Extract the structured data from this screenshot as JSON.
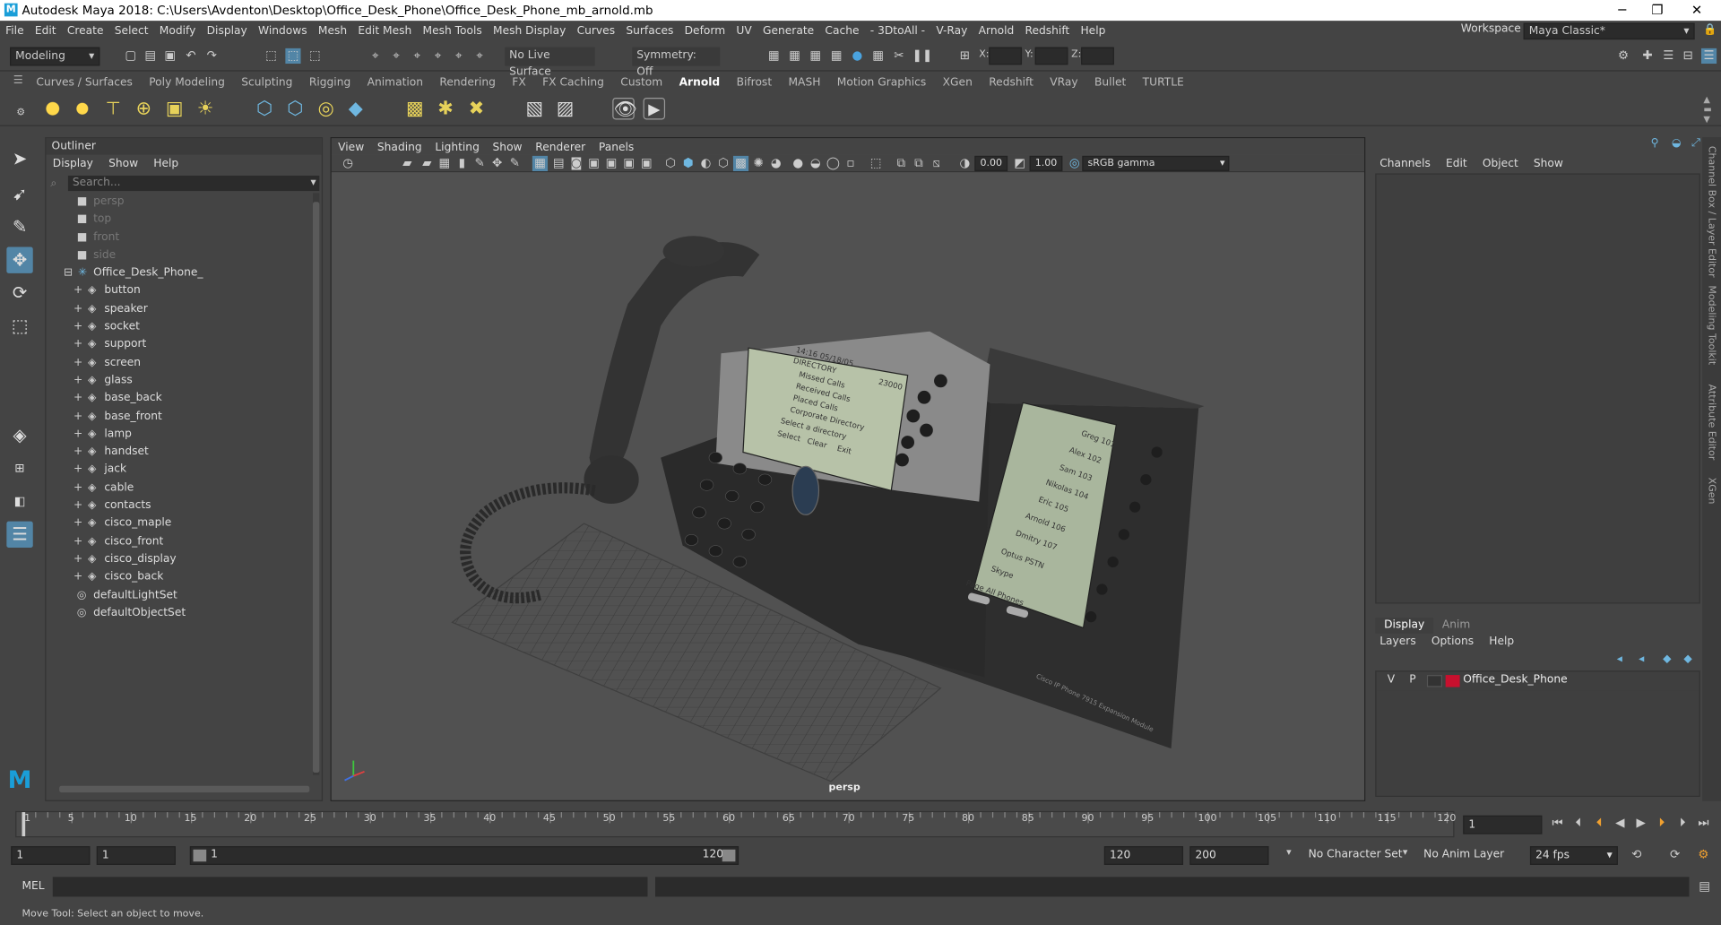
{
  "title": "Autodesk Maya 2018: C:\\Users\\Avdenton\\Desktop\\Office_Desk_Phone\\Office_Desk_Phone_mb_arnold.mb",
  "menu": [
    "File",
    "Edit",
    "Create",
    "Select",
    "Modify",
    "Display",
    "Windows",
    "Mesh",
    "Edit Mesh",
    "Mesh Tools",
    "Mesh Display",
    "Curves",
    "Surfaces",
    "Deform",
    "UV",
    "Generate",
    "Cache",
    "- 3DtoAll -",
    "V-Ray",
    "Arnold",
    "Redshift",
    "Help"
  ],
  "workspace": {
    "label": "Workspace :",
    "value": "Maya Classic*"
  },
  "toolbar": {
    "mode": "Modeling",
    "live_surface": "No Live Surface",
    "symmetry": "Symmetry: Off",
    "x_label": "X:",
    "y_label": "Y:",
    "z_label": "Z:"
  },
  "shelf_tabs": [
    "Curves / Surfaces",
    "Poly Modeling",
    "Sculpting",
    "Rigging",
    "Animation",
    "Rendering",
    "FX",
    "FX Caching",
    "Custom",
    "Arnold",
    "Bifrost",
    "MASH",
    "Motion Graphics",
    "XGen",
    "Redshift",
    "VRay",
    "Bullet",
    "TURTLE"
  ],
  "active_shelf_tab": "Arnold",
  "outliner": {
    "title": "Outliner",
    "menu": [
      "Display",
      "Show",
      "Help"
    ],
    "search_placeholder": "Search...",
    "cameras": [
      "persp",
      "top",
      "front",
      "side"
    ],
    "group": "Office_Desk_Phone_",
    "children": [
      "button",
      "speaker",
      "socket",
      "support",
      "screen",
      "glass",
      "base_back",
      "base_front",
      "lamp",
      "handset",
      "jack",
      "cable",
      "contacts",
      "cisco_maple",
      "cisco_front",
      "cisco_display",
      "cisco_back"
    ],
    "sets": [
      "defaultLightSet",
      "defaultObjectSet"
    ]
  },
  "viewport": {
    "menu": [
      "View",
      "Shading",
      "Lighting",
      "Show",
      "Renderer",
      "Panels"
    ],
    "exposure": "0.00",
    "gamma": "1.00",
    "color_space": "sRGB gamma",
    "camera_label": "persp",
    "phone_screen_lines": [
      "14:16 05/18/05",
      "DIRECTORY",
      "Missed Calls",
      "Received Calls",
      "Placed Calls",
      "Corporate Directory",
      "Select a directory",
      "Select",
      "Clear",
      "Exit"
    ],
    "phone_header": "23000",
    "expansion_lines": [
      "Greg 101",
      "Alex 102",
      "Sam 103",
      "Nikolas 104",
      "Eric 105",
      "Arnold 106",
      "Dmitry 107",
      "Optus PSTN",
      "Skype",
      "Page All Phones"
    ],
    "brand_text": "Cisco IP Phone 7915 Expansion Module"
  },
  "channel_box": {
    "menu": [
      "Channels",
      "Edit",
      "Object",
      "Show"
    ],
    "layer_tabs": [
      "Display",
      "Anim"
    ],
    "layer_menu": [
      "Layers",
      "Options",
      "Help"
    ],
    "layer": {
      "v": "V",
      "p": "P",
      "name": "Office_Desk_Phone",
      "color": "#c8102e"
    }
  },
  "side_tabs": [
    "Channel Box / Layer Editor",
    "Modeling Toolkit",
    "Attribute Editor",
    "XGen"
  ],
  "timeline": {
    "ticks": [
      1,
      5,
      10,
      15,
      20,
      25,
      30,
      35,
      40,
      45,
      50,
      55,
      60,
      65,
      70,
      75,
      80,
      85,
      90,
      95,
      100,
      105,
      110,
      115,
      120
    ],
    "current_frame": "1"
  },
  "range": {
    "start": "1",
    "playback_start": "1",
    "slider_start": "1",
    "slider_end": "120",
    "playback_end": "120",
    "end": "200",
    "character_set": "No Character Set",
    "anim_layer": "No Anim Layer",
    "fps": "24 fps"
  },
  "command_line": {
    "label": "MEL"
  },
  "help_line": "Move Tool: Select an object to move."
}
